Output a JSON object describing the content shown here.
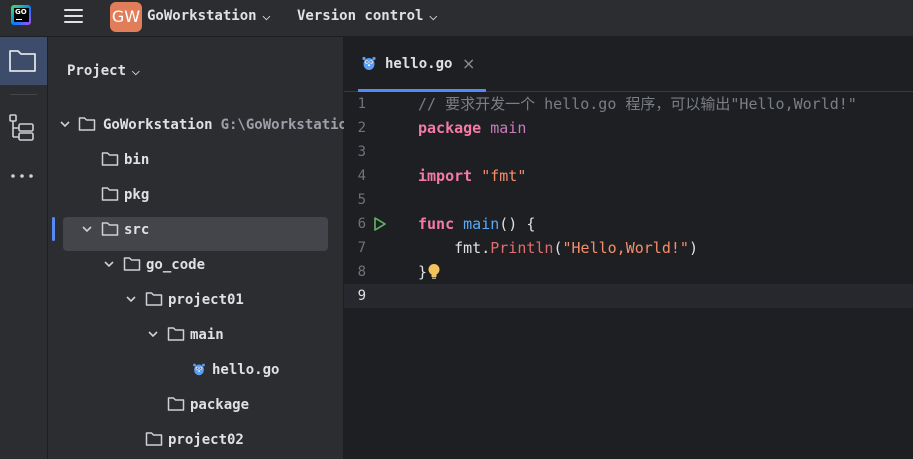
{
  "titlebar": {
    "logo_text": "GO",
    "project_badge": "GW",
    "project_name": "GoWorkstation",
    "vcs_label": "Version control"
  },
  "project_panel": {
    "title": "Project",
    "tree": [
      {
        "label": "GoWorkstation",
        "path": "G:\\GoWorkstation",
        "type": "folder",
        "expanded": true
      },
      {
        "label": "bin",
        "type": "folder"
      },
      {
        "label": "pkg",
        "type": "folder"
      },
      {
        "label": "src",
        "type": "folder",
        "expanded": true,
        "selected": true
      },
      {
        "label": "go_code",
        "type": "folder",
        "expanded": true
      },
      {
        "label": "project01",
        "type": "folder",
        "expanded": true
      },
      {
        "label": "main",
        "type": "folder",
        "expanded": true
      },
      {
        "label": "hello.go",
        "type": "go-file"
      },
      {
        "label": "package",
        "type": "folder"
      },
      {
        "label": "project02",
        "type": "folder"
      }
    ]
  },
  "editor": {
    "tab_label": "hello.go",
    "current_line": 9,
    "lines": [
      {
        "n": "1",
        "comment": "// 要求开发一个 hello.go 程序，可以输出\"Hello,World!\""
      },
      {
        "n": "2",
        "kw": "package",
        "rest": " main"
      },
      {
        "n": "3"
      },
      {
        "n": "4",
        "kw": "import",
        "str": "\"fmt\""
      },
      {
        "n": "5"
      },
      {
        "n": "6",
        "kw": "func",
        "fn": "main",
        "rest": "() {"
      },
      {
        "n": "7",
        "pkg": "fmt",
        "call": "Println",
        "str": "\"Hello,World!\""
      },
      {
        "n": "8",
        "rest": "}"
      },
      {
        "n": "9"
      }
    ]
  },
  "colors": {
    "accent": "#548af7",
    "keyword": "#cf8e6d",
    "string": "#f58e6d",
    "comment": "#7a7e85",
    "function": "#57aaf7"
  }
}
